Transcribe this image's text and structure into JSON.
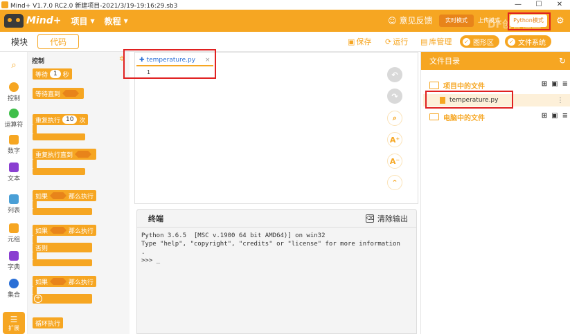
{
  "window": {
    "title": "Mind+ V1.7.0 RC2.0  新建项目-2021/3/19-19:16:29.sb3",
    "controls": [
      "—",
      "☐",
      "✕"
    ]
  },
  "menubar": {
    "logo": "Mind+",
    "project": "项目",
    "tutorial": "教程",
    "feedback": "意见反馈",
    "realtime_mode": "实时模式",
    "upload_mode": "上传模式",
    "python_mode": "Python模式"
  },
  "tabs": {
    "blocks": "模块",
    "code": "代码"
  },
  "toolbar": {
    "save": "保存",
    "run": "运行",
    "library": "库管理",
    "graphics": "图形区",
    "filesystem": "文件系统"
  },
  "categories": [
    {
      "label": "控制",
      "color": "#f6a622"
    },
    {
      "label": "运算符",
      "color": "#3fbf4a"
    },
    {
      "label": "数字",
      "color": "#f6a622"
    },
    {
      "label": "文本",
      "color": "#8a3fd1"
    },
    {
      "label": "列表",
      "color": "#4a9fd6"
    },
    {
      "label": "元组",
      "color": "#f6a622"
    },
    {
      "label": "字典",
      "color": "#8a3fd1"
    },
    {
      "label": "集合",
      "color": "#2a6fd6"
    }
  ],
  "extension": "扩展",
  "palette": {
    "title": "控制",
    "wait": "等待",
    "wait_value": "1",
    "wait_unit": "秒",
    "wait_until": "等待直到",
    "repeat": "重复执行",
    "repeat_value": "10",
    "repeat_unit": "次",
    "repeat_until": "重复执行直到",
    "if": "如果",
    "then": "那么执行",
    "if2": "如果",
    "then2": "那么执行",
    "else": "否则",
    "if3": "如果",
    "then3": "那么执行",
    "loop": "循环执行"
  },
  "editor": {
    "file_tab": "temperature.py",
    "line": "1"
  },
  "terminal": {
    "title": "终端",
    "clear": "清除输出",
    "output": "Python 3.6.5  [MSC v.1900 64 bit AMD64)] on win32\nType \"help\", \"copyright\", \"credits\" or \"license\" for more information\n.\n>>> _"
  },
  "files": {
    "header": "文件目录",
    "project_files": "项目中的文件",
    "file": "temperature.py",
    "computer_files": "电脑中的文件"
  },
  "watermark": "DF创客社区"
}
